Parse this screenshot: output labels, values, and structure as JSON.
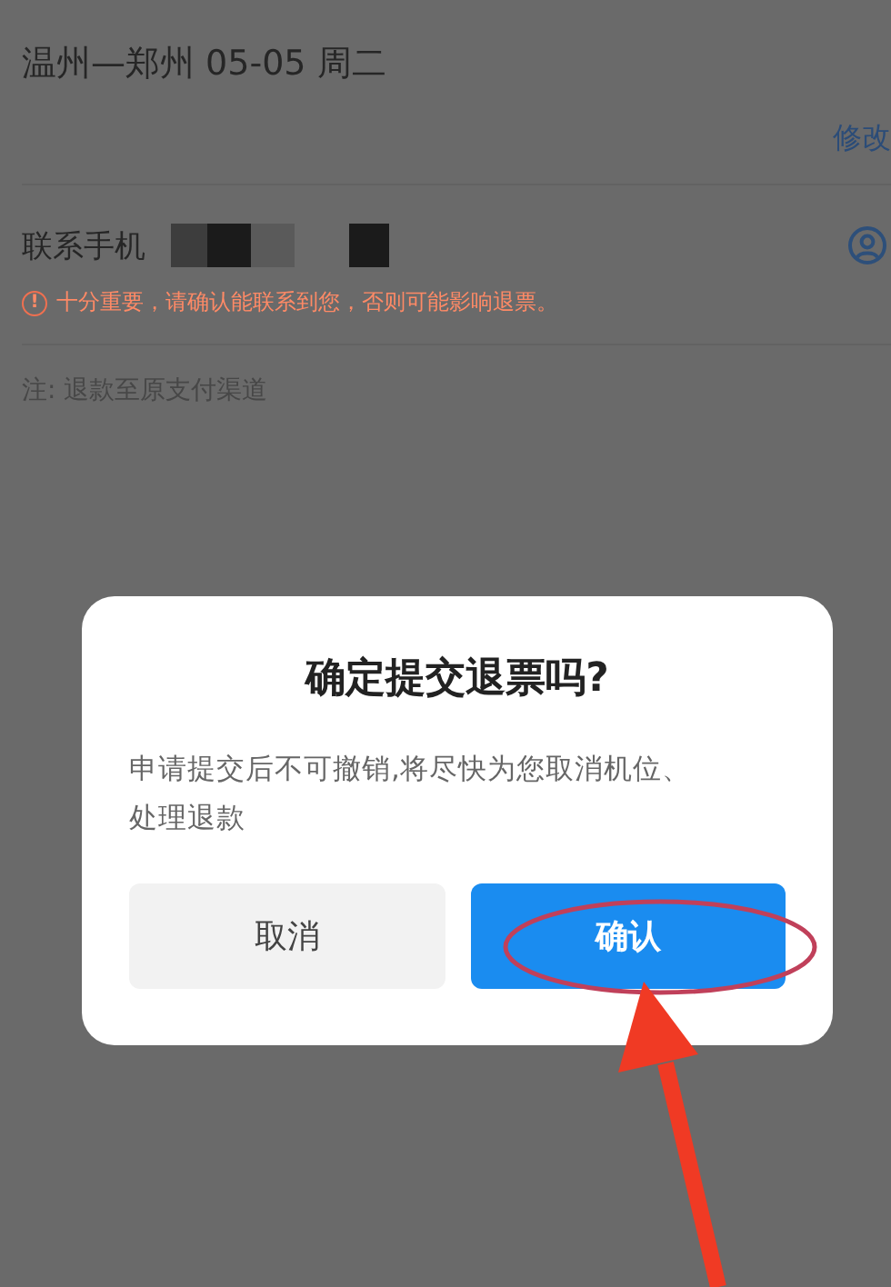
{
  "trip": {
    "route": "温州—郑州 05-05 周二",
    "edit_link": "修改"
  },
  "contact": {
    "label": "联系手机",
    "warning_icon": "!",
    "warning": "十分重要，请确认能联系到您，否则可能影响退票。"
  },
  "note": "注: 退款至原支付渠道",
  "dialog": {
    "title": "确定提交退票吗?",
    "message": "申请提交后不可撤销,将尽快为您取消机位、处理退款",
    "buttons": [
      {
        "label": "取消",
        "kind": "secondary"
      },
      {
        "label": "确认",
        "kind": "primary"
      }
    ]
  }
}
